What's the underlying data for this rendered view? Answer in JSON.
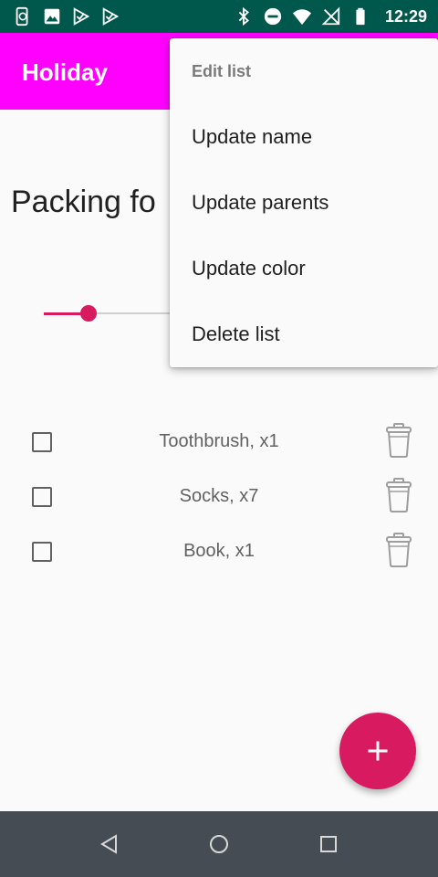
{
  "status_bar": {
    "time": "12:29",
    "left_icons": [
      "phone-sync-icon",
      "image-icon",
      "check-flag-icon",
      "check-flag-icon"
    ],
    "right_icons": [
      "bluetooth-icon",
      "do-not-disturb-icon",
      "wifi-icon",
      "no-signal-icon",
      "battery-icon"
    ]
  },
  "app_bar": {
    "title": "Holiday",
    "color": "#ff00ff"
  },
  "list_title": "Packing fo",
  "slider": {
    "value_fraction": 0.33,
    "color": "#d81b60"
  },
  "items": [
    {
      "label": "Toothbrush, x1",
      "checked": false
    },
    {
      "label": "Socks, x7",
      "checked": false
    },
    {
      "label": "Book, x1",
      "checked": false
    }
  ],
  "fab": {
    "icon": "plus-icon",
    "color": "#d81b60"
  },
  "menu": {
    "header": "Edit list",
    "items": [
      "Update name",
      "Update parents",
      "Update color",
      "Delete list"
    ]
  },
  "nav_bar": {
    "icons": [
      "back-triangle-icon",
      "home-circle-icon",
      "recents-square-icon"
    ]
  }
}
